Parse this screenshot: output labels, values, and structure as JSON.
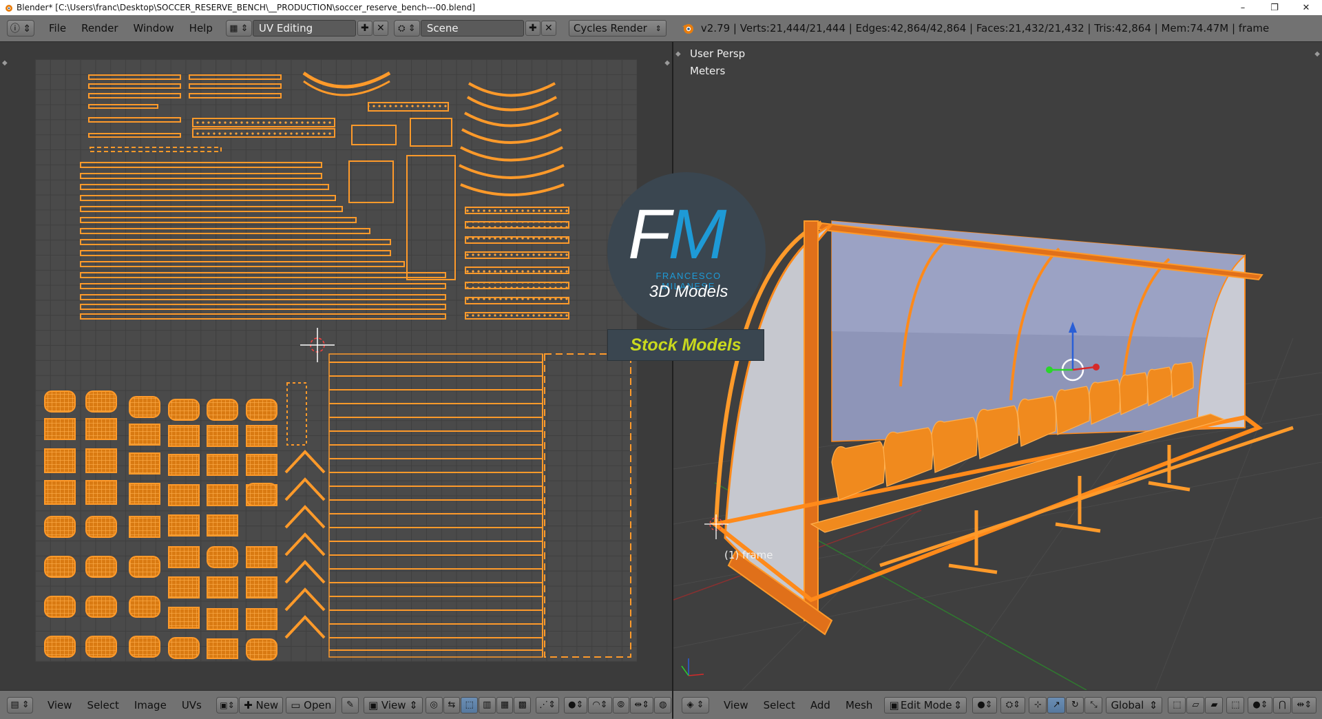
{
  "window": {
    "title": "Blender* [C:\\Users\\franc\\Desktop\\SOCCER_RESERVE_BENCH\\__PRODUCTION\\soccer_reserve_bench---00.blend]",
    "minimize": "–",
    "restore": "❐",
    "close": "✕"
  },
  "infobar": {
    "menus": [
      "File",
      "Render",
      "Window",
      "Help"
    ],
    "screen_layout": "UV Editing",
    "scene": "Scene",
    "render_engine": "Cycles Render",
    "stats": "v2.79 | Verts:21,444/21,444 | Edges:42,864/42,864 | Faces:21,432/21,432 | Tris:42,864 | Mem:74.47M | frame"
  },
  "viewport": {
    "view_name": "User Persp",
    "units": "Meters",
    "object_label": "(1) frame"
  },
  "watermark": {
    "fm_f": "F",
    "fm_m": "M",
    "author": "FRANCESCO MILANESE",
    "subtitle": "3D Models",
    "ribbon": "Stock Models"
  },
  "uv_footer": {
    "menus": [
      "View",
      "Select",
      "Image",
      "UVs"
    ],
    "new_label": "New",
    "open_label": "Open",
    "view_label": "View"
  },
  "view3d_footer": {
    "menus": [
      "View",
      "Select",
      "Add",
      "Mesh"
    ],
    "mode": "Edit Mode",
    "orientation": "Global"
  },
  "colors": {
    "wire": "#ff8a1a",
    "selection_fill": "#f08000",
    "header": "#727272",
    "accent_blue": "#1e9ad6"
  }
}
